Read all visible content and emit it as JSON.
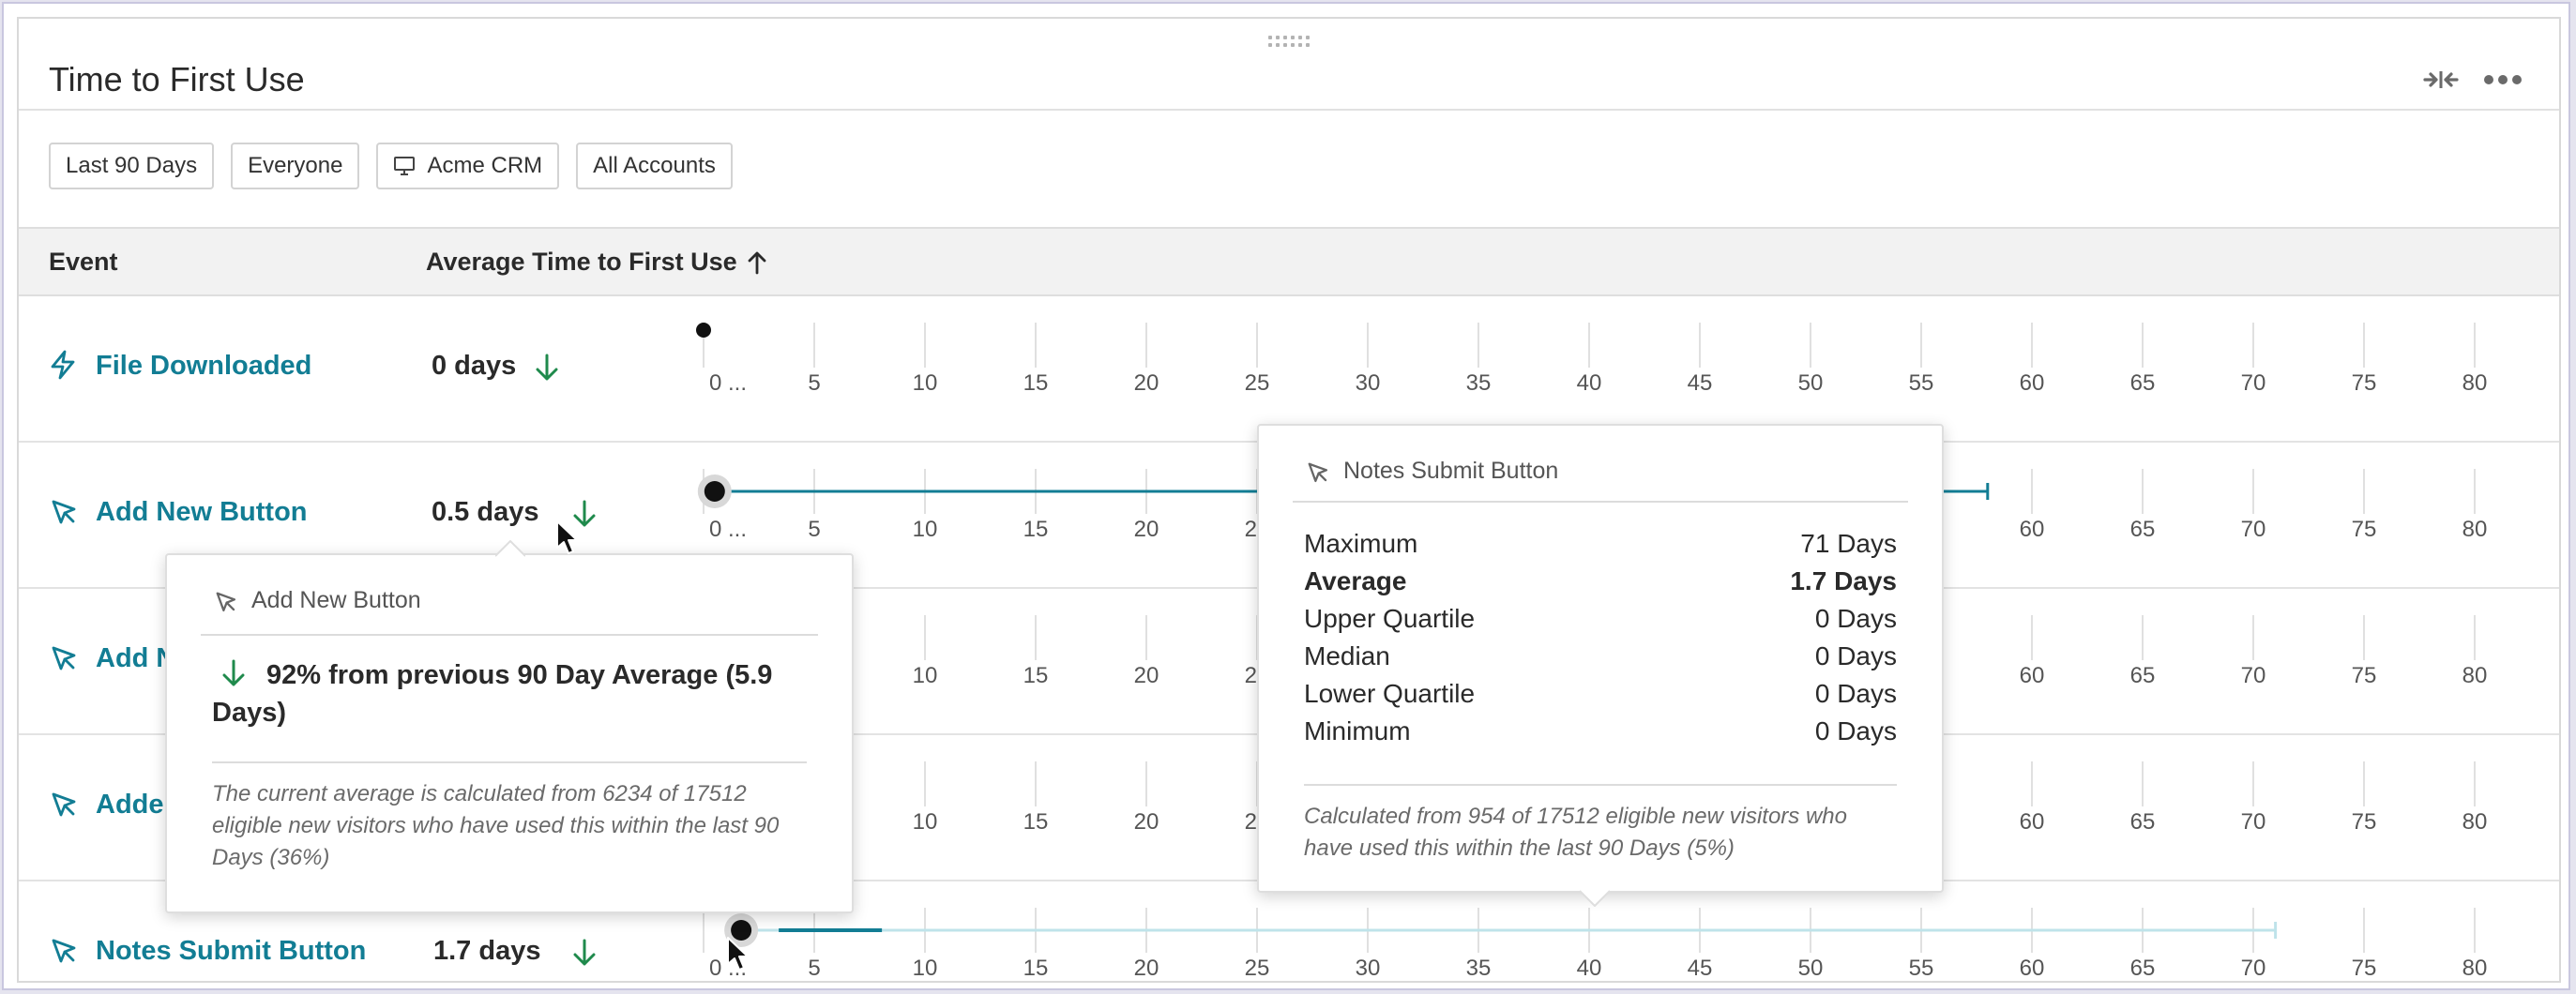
{
  "widget": {
    "title": "Time to First Use",
    "collapse_icon": "collapse-arrows-icon",
    "menu_icon": "more-options-icon"
  },
  "filters": [
    {
      "label": "Last 90 Days",
      "icon": ""
    },
    {
      "label": "Everyone",
      "icon": ""
    },
    {
      "label": "Acme CRM",
      "icon": "monitor-icon"
    },
    {
      "label": "All Accounts",
      "icon": ""
    }
  ],
  "table": {
    "headers": {
      "event": "Event",
      "avg": "Average Time to First Use",
      "sort_icon": "sort-ascending-arrow-icon"
    },
    "axis_ticks": [
      "0 ...",
      "5",
      "10",
      "15",
      "20",
      "25",
      "30",
      "35",
      "40",
      "45",
      "50",
      "55",
      "60",
      "65",
      "70",
      "75",
      "80"
    ],
    "rows": [
      {
        "event": "File Downloaded",
        "icon": "lightning-icon",
        "avg": "0 days",
        "trend": "down"
      },
      {
        "event": "Add New Button",
        "icon": "cursor-click-icon",
        "avg": "0.5 days",
        "trend": "down"
      },
      {
        "event": "Add N",
        "icon": "cursor-click-icon",
        "avg": "",
        "trend": ""
      },
      {
        "event": "Adde",
        "icon": "cursor-click-icon",
        "avg": "",
        "trend": ""
      },
      {
        "event": "Notes Submit Button",
        "icon": "cursor-click-icon",
        "avg": "1.7 days",
        "trend": "down"
      }
    ]
  },
  "tooltip_trend": {
    "title": "Add New Button",
    "icon": "cursor-click-icon",
    "change": "92% from previous 90 Day Average (5.9 Days)",
    "note": "The current average is calculated from 6234 of 17512 eligible new visitors who have used this within the last 90 Days (36%)"
  },
  "tooltip_stats": {
    "title": "Notes Submit Button",
    "icon": "cursor-click-icon",
    "stats": [
      {
        "label": "Maximum",
        "value": "71 Days",
        "bold": false
      },
      {
        "label": "Average",
        "value": "1.7 Days",
        "bold": true
      },
      {
        "label": "Upper Quartile",
        "value": "0 Days",
        "bold": false
      },
      {
        "label": "Median",
        "value": "0 Days",
        "bold": false
      },
      {
        "label": "Lower Quartile",
        "value": "0 Days",
        "bold": false
      },
      {
        "label": "Minimum",
        "value": "0 Days",
        "bold": false
      }
    ],
    "note": "Calculated from 954 of 17512 eligible new visitors who have used this within the last 90 Days (5%)"
  },
  "colors": {
    "link": "#127d94",
    "trend_down": "#1f8a4c",
    "range_line": "#127d94"
  },
  "chart_data": {
    "type": "box-range",
    "x_unit": "days",
    "xlim": [
      0,
      80
    ],
    "rows": [
      {
        "event": "File Downloaded",
        "average": 0,
        "max": 0
      },
      {
        "event": "Add New Button",
        "average": 0.5,
        "max": 58
      },
      {
        "event": "Notes Submit Button",
        "average": 1.7,
        "max": 71
      }
    ]
  }
}
